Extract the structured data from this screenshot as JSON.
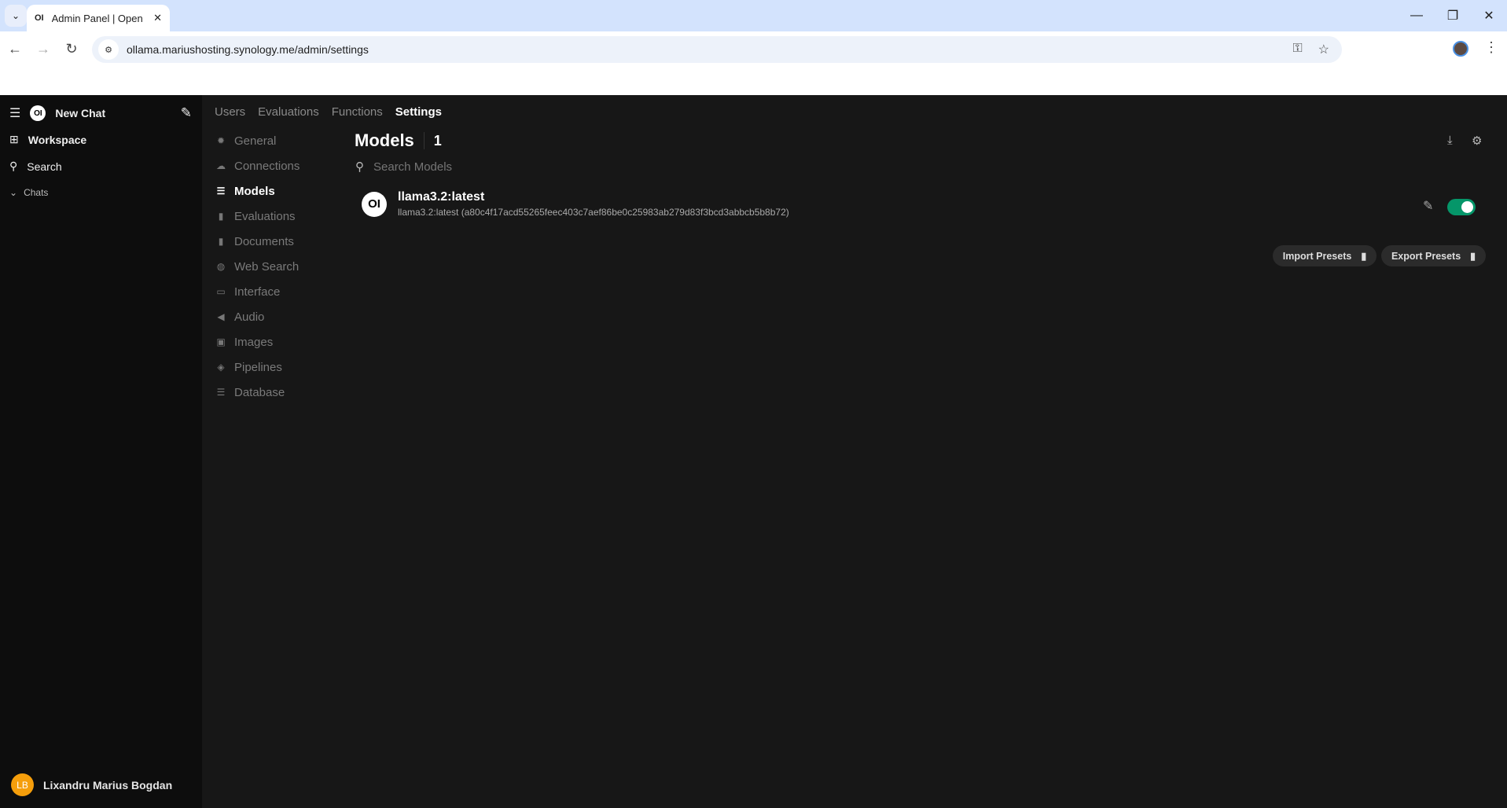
{
  "browser": {
    "tab_title": "Admin Panel | Open WebUI",
    "tab_favicon": "OI",
    "url": "ollama.mariushosting.synology.me/admin/settings"
  },
  "sidebar": {
    "logo": "OI",
    "new_chat": "New Chat",
    "workspace": "Workspace",
    "search": "Search",
    "chats": "Chats",
    "user_initials": "LB",
    "user_name": "Lixandru Marius Bogdan"
  },
  "topnav": [
    {
      "label": "Users"
    },
    {
      "label": "Evaluations"
    },
    {
      "label": "Functions"
    },
    {
      "label": "Settings",
      "active": true
    }
  ],
  "submenu": [
    {
      "label": "General",
      "icon": "gear-icon"
    },
    {
      "label": "Connections",
      "icon": "cloud-icon"
    },
    {
      "label": "Models",
      "icon": "database-icon",
      "active": true
    },
    {
      "label": "Evaluations",
      "icon": "document-chart-icon"
    },
    {
      "label": "Documents",
      "icon": "document-icon"
    },
    {
      "label": "Web Search",
      "icon": "globe-icon"
    },
    {
      "label": "Interface",
      "icon": "monitor-icon"
    },
    {
      "label": "Audio",
      "icon": "speaker-icon"
    },
    {
      "label": "Images",
      "icon": "image-icon"
    },
    {
      "label": "Pipelines",
      "icon": "layers-icon"
    },
    {
      "label": "Database",
      "icon": "database-icon"
    }
  ],
  "models": {
    "title": "Models",
    "count": "1",
    "search_placeholder": "Search Models",
    "items": [
      {
        "avatar": "OI",
        "name": "llama3.2:latest",
        "description": "llama3.2:latest (a80c4f17acd55265feec403c7aef86be0c25983ab279d83f3bcd3abbcb5b8b72)",
        "enabled": true
      }
    ],
    "import_label": "Import Presets",
    "export_label": "Export Presets"
  },
  "colors": {
    "toggle_on": "#059669",
    "avatar": "#f59e0b"
  }
}
